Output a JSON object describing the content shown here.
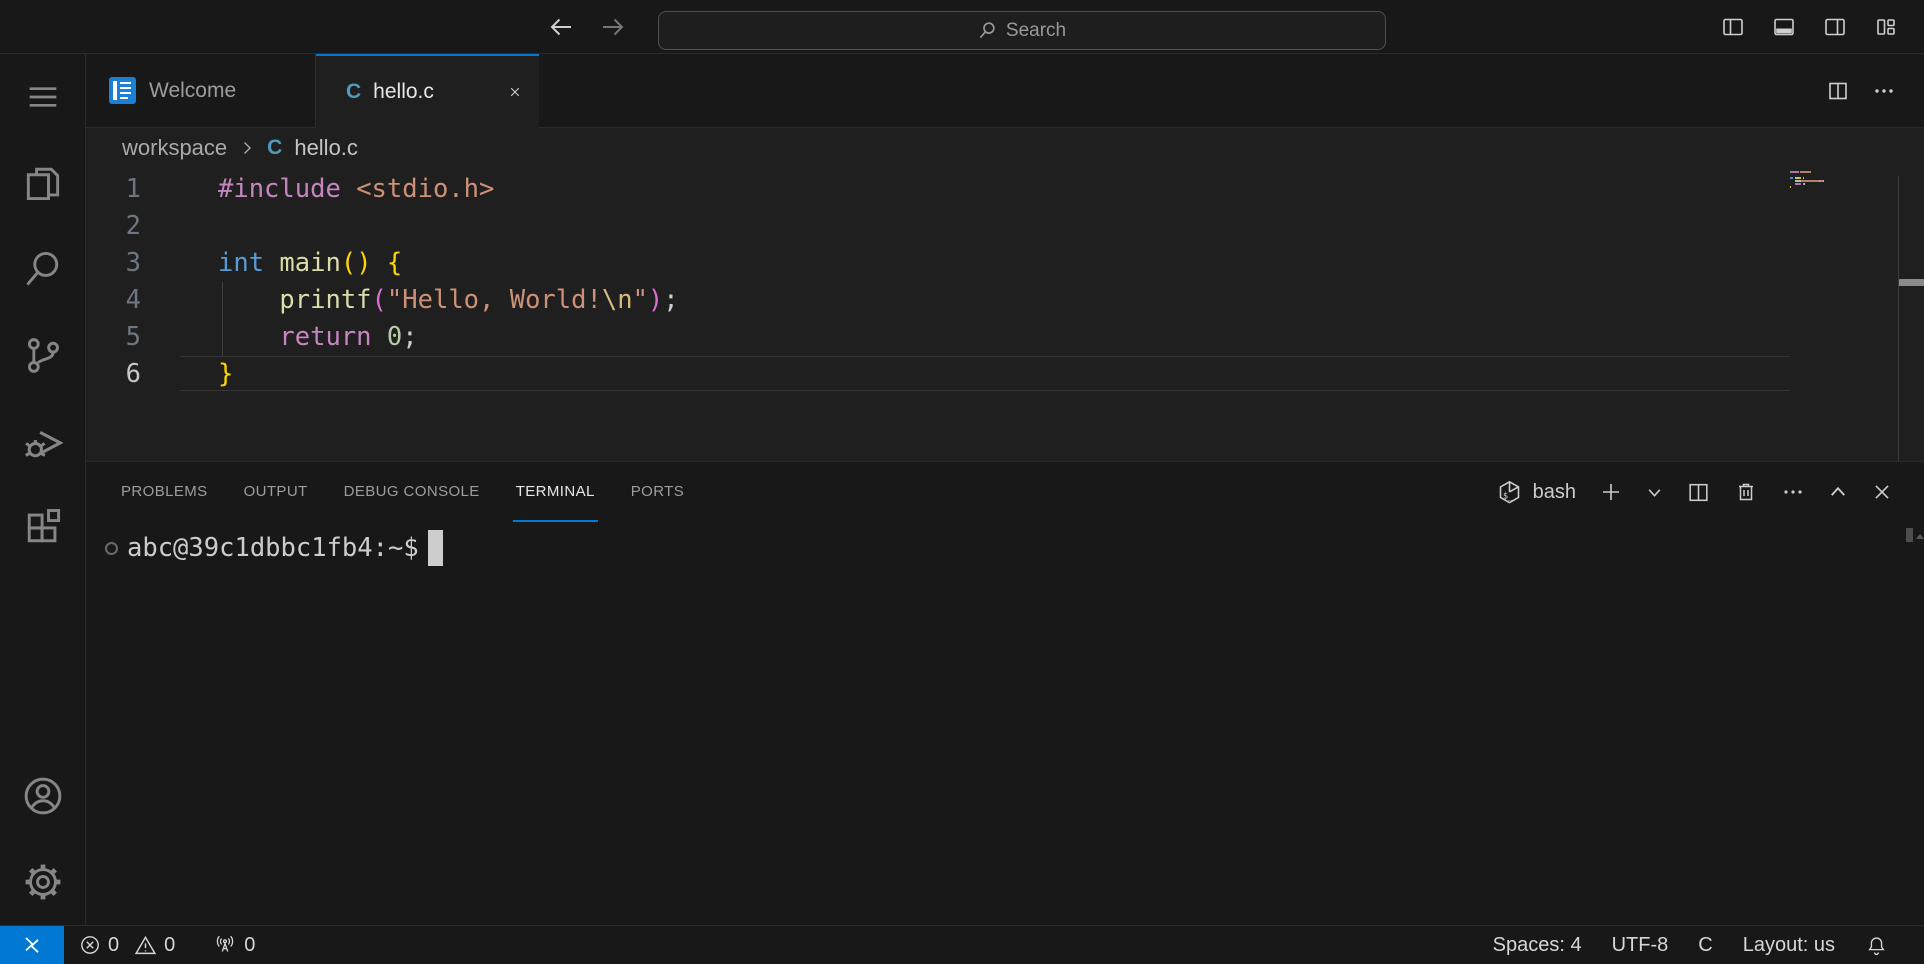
{
  "title_bar": {
    "search_label": "Search",
    "right_icons": [
      "toggle-primary-sidebar",
      "toggle-panel",
      "toggle-secondary-sidebar",
      "customize-layout"
    ]
  },
  "activity_bar": {
    "items": [
      "menu",
      "explorer",
      "search",
      "source-control",
      "run-and-debug",
      "extensions"
    ],
    "bottom_items": [
      "accounts",
      "settings"
    ]
  },
  "editor_tabs": [
    {
      "label": "Welcome",
      "icon": "welcome-book",
      "active": false
    },
    {
      "label": "hello.c",
      "icon": "c-file",
      "active": true,
      "closable": true
    }
  ],
  "breadcrumb": {
    "folder": "workspace",
    "file": "hello.c"
  },
  "glyphs": {
    "c_icon": "C",
    "bash_dollar": "$"
  },
  "accent_colors": {
    "focus_blue": "#0078d4",
    "c_file_blue": "#519aba",
    "welcome_icon_blue": "#1b7fd4"
  },
  "editor": {
    "language": "c",
    "active_line": 6,
    "syntax_colors": {
      "preproc": "#C586C0",
      "string": "#CE9178",
      "escape": "#D7BA7D",
      "keyword": "#569CD6",
      "control": "#C586C0",
      "function": "#DCDCAA",
      "number": "#B5CEA8",
      "punct": "#CCCCCC",
      "bracket1": "#FFD700",
      "bracket2": "#DA70D6",
      "plain": "#CCCCCC"
    },
    "lines": [
      {
        "num": "1",
        "tokens": [
          {
            "text": "#include",
            "type": "preproc"
          },
          {
            "text": " ",
            "type": "plain"
          },
          {
            "text": "<stdio.h>",
            "type": "string"
          }
        ]
      },
      {
        "num": "2",
        "tokens": []
      },
      {
        "num": "3",
        "tokens": [
          {
            "text": "int",
            "type": "keyword"
          },
          {
            "text": " ",
            "type": "plain"
          },
          {
            "text": "main",
            "type": "function"
          },
          {
            "text": "()",
            "type": "bracket1"
          },
          {
            "text": " ",
            "type": "plain"
          },
          {
            "text": "{",
            "type": "bracket1"
          }
        ]
      },
      {
        "num": "4",
        "tokens": [
          {
            "text": "    ",
            "type": "plain"
          },
          {
            "text": "printf",
            "type": "function"
          },
          {
            "text": "(",
            "type": "bracket2"
          },
          {
            "text": "\"Hello, World!",
            "type": "string"
          },
          {
            "text": "\\n",
            "type": "escape"
          },
          {
            "text": "\"",
            "type": "string"
          },
          {
            "text": ")",
            "type": "bracket2"
          },
          {
            "text": ";",
            "type": "punct"
          }
        ]
      },
      {
        "num": "5",
        "tokens": [
          {
            "text": "    ",
            "type": "plain"
          },
          {
            "text": "return",
            "type": "control"
          },
          {
            "text": " ",
            "type": "plain"
          },
          {
            "text": "0",
            "type": "number"
          },
          {
            "text": ";",
            "type": "punct"
          }
        ]
      },
      {
        "num": "6",
        "tokens": [
          {
            "text": "}",
            "type": "bracket1"
          }
        ]
      }
    ]
  },
  "panel": {
    "tabs": [
      {
        "label": "PROBLEMS",
        "active": false
      },
      {
        "label": "OUTPUT",
        "active": false
      },
      {
        "label": "DEBUG CONSOLE",
        "active": false
      },
      {
        "label": "TERMINAL",
        "active": true
      },
      {
        "label": "PORTS",
        "active": false
      }
    ],
    "shell_label": "bash",
    "toolbar_icons": [
      "new-terminal",
      "launch-profile-chevron",
      "split-terminal",
      "kill-terminal",
      "more-actions",
      "maximize-panel",
      "close-panel"
    ]
  },
  "terminal": {
    "prompt": "abc@39c1dbbc1fb4:~$"
  },
  "status_bar": {
    "errors": "0",
    "warnings": "0",
    "ports": "0",
    "indent": "Spaces: 4",
    "encoding": "UTF-8",
    "language": "C",
    "keyboard_layout": "Layout: us"
  }
}
